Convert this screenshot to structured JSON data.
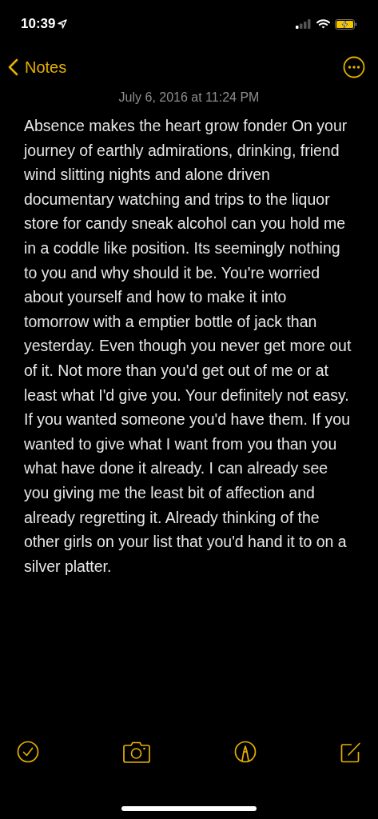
{
  "status_bar": {
    "time": "10:39"
  },
  "nav": {
    "back_label": "Notes"
  },
  "note": {
    "date": "July 6, 2016 at 11:24 PM",
    "body": "Absence makes the heart grow fonder On your journey of earthly admirations, drinking, friend wind slitting nights and alone driven documentary watching and trips to the liquor store for candy sneak alcohol can you hold me in a coddle like position. Its seemingly nothing to you and why should it be. You're worried about yourself and how to make it into tomorrow with a emptier bottle of jack than yesterday. Even though you never get more out of it. Not more than you'd get out of me or at least what I'd give you. Your definitely not easy. If you wanted someone you'd have them. If you wanted to give what I want from you than you what have done it already. I can already see you giving me the least bit of affection and already regretting it. Already thinking of the other girls on your list that you'd hand it to on a silver platter."
  }
}
